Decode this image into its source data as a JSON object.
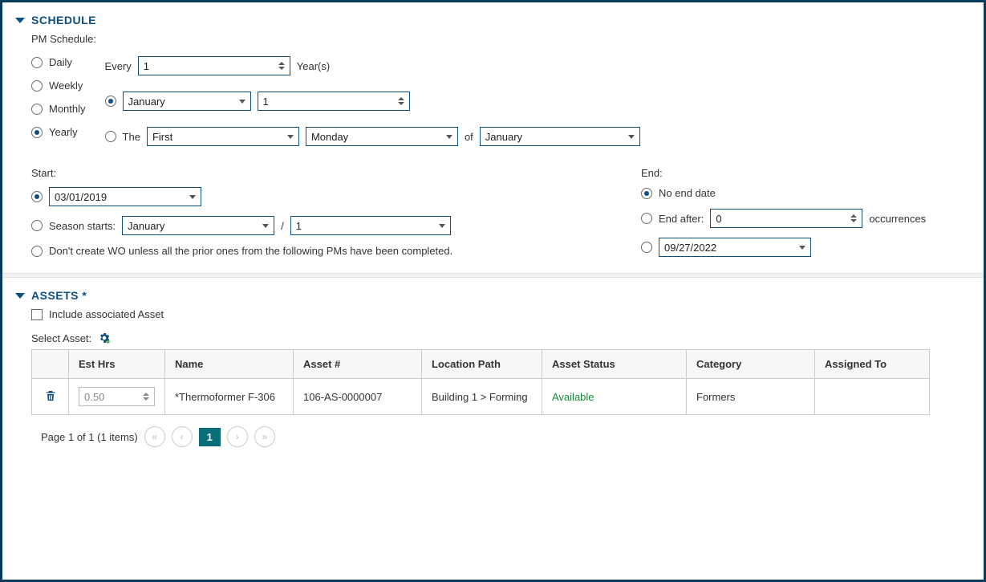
{
  "schedule": {
    "title": "SCHEDULE",
    "pm_schedule_label": "PM Schedule:",
    "freq": {
      "daily": "Daily",
      "weekly": "Weekly",
      "monthly": "Monthly",
      "yearly": "Yearly"
    },
    "every_label": "Every",
    "every_value": "1",
    "years_label": "Year(s)",
    "month_value": "January",
    "day_value": "1",
    "the_label": "The",
    "ordinal_value": "First",
    "weekday_value": "Monday",
    "of_label": "of",
    "of_month_value": "January",
    "start_label": "Start:",
    "start_date": "03/01/2019",
    "season_starts_label": "Season starts:",
    "season_month": "January",
    "season_day": "1",
    "slash": "/",
    "dont_create_label": "Don't create WO unless all the prior ones from the following PMs have been completed.",
    "end_label": "End:",
    "no_end_label": "No end date",
    "end_after_label": "End after:",
    "end_after_value": "0",
    "occurrences_label": "occurrences",
    "end_date_value": "09/27/2022"
  },
  "assets": {
    "title": "ASSETS *",
    "include_label": "Include associated Asset",
    "select_label": "Select Asset:",
    "columns": {
      "est_hrs": "Est Hrs",
      "name": "Name",
      "asset_num": "Asset #",
      "location": "Location Path",
      "status": "Asset Status",
      "category": "Category",
      "assigned_to": "Assigned To"
    },
    "row": {
      "est_hrs": "0.50",
      "name": "*Thermoformer F-306",
      "asset_num": "106-AS-0000007",
      "location": "Building 1 > Forming",
      "status": "Available",
      "category": "Formers",
      "assigned_to": ""
    },
    "pager_label": "Page 1 of 1 (1 items)",
    "pager_current": "1"
  }
}
